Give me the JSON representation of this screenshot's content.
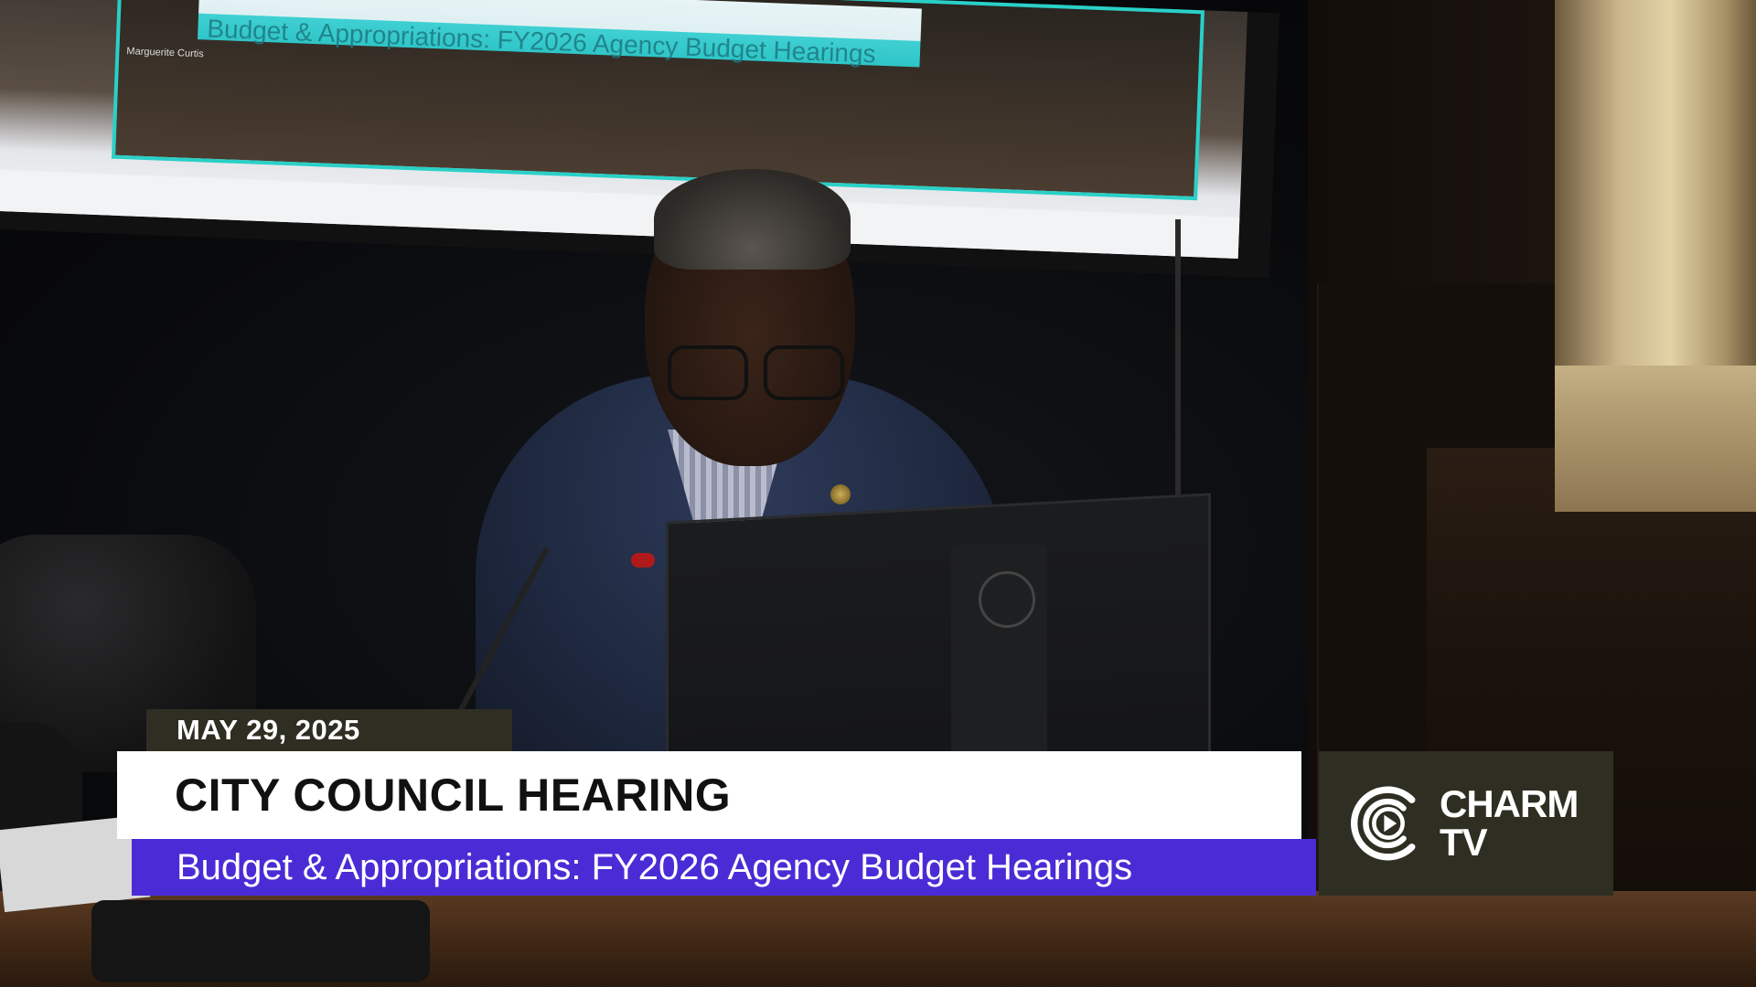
{
  "overlay": {
    "date": "MAY 29, 2025",
    "title": "CITY COUNCIL HEARING",
    "subtitle": "Budget & Appropriations: FY2026 Agency Budget Hearings"
  },
  "logo": {
    "line1": "CHARM",
    "line2": "TV",
    "icon": "charm-tv-play-icon"
  },
  "background_screen": {
    "banner_text": "Budget & Appropriations: FY2026 Agency Budget Hearings",
    "caption": "Marguerite Curtis"
  },
  "colors": {
    "subtitle_bar": "#4a2cd6",
    "date_tab": "#2f2e22",
    "logo_box": "#2f2e22",
    "title_bar": "#ffffff",
    "screen_border": "#29d0c8"
  }
}
